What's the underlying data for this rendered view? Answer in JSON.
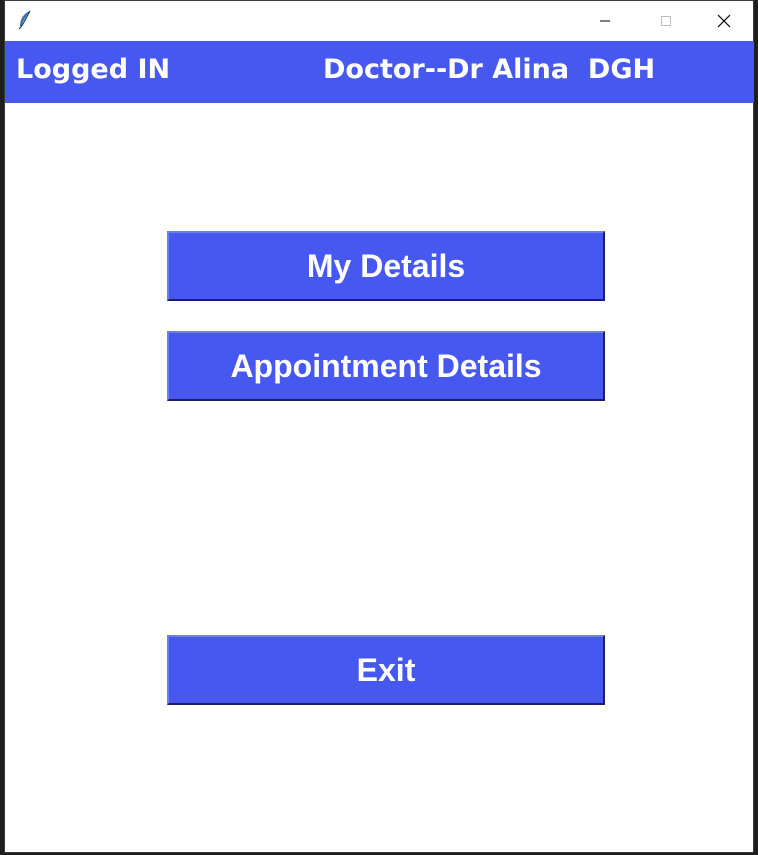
{
  "window": {
    "icon": "feather-icon",
    "controls": [
      "minimize-icon",
      "maximize-icon",
      "close-icon"
    ]
  },
  "header": {
    "status": "Logged IN",
    "user": "Doctor--Dr Alina  DGH"
  },
  "menu": {
    "my_details_label": "My Details",
    "appointment_details_label": "Appointment Details",
    "exit_label": "Exit"
  },
  "colors": {
    "accent": "#4758f0",
    "text_on_accent": "#ffffff",
    "background": "#ffffff"
  }
}
